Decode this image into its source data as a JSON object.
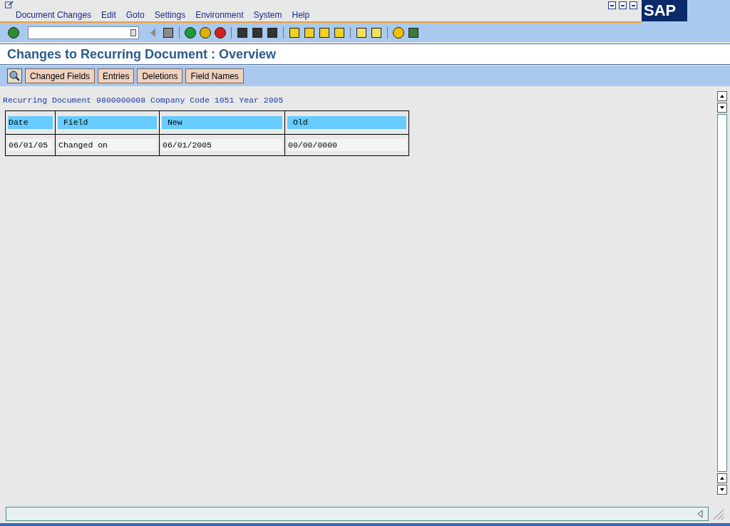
{
  "menu": [
    "Document Changes",
    "Edit",
    "Goto",
    "Settings",
    "Environment",
    "System",
    "Help"
  ],
  "logo": "SAP",
  "title": "Changes to Recurring Document : Overview",
  "app_buttons": [
    "Changed Fields",
    "Entries",
    "Deletions",
    "Field Names"
  ],
  "header_line": "Recurring Document 9800000008 Company Code 1051 Year 2005",
  "table": {
    "columns": [
      "Date",
      "Field",
      "New",
      "Old"
    ],
    "rows": [
      [
        "06/01/05",
        "Changed on",
        "06/01/2005",
        "00/00/0000"
      ]
    ]
  }
}
